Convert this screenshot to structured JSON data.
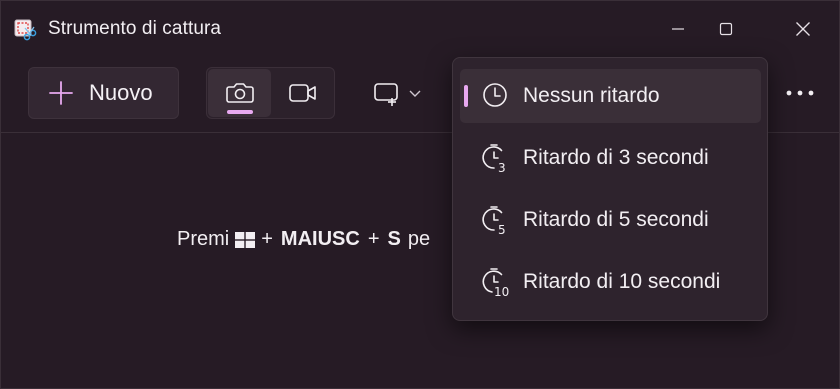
{
  "window": {
    "title": "Strumento di cattura"
  },
  "toolbar": {
    "new_label": "Nuovo"
  },
  "content": {
    "hint_prefix": "Premi",
    "hint_plus1": "+",
    "hint_key1": "MAIUSC",
    "hint_plus2": "+",
    "hint_key2": "S",
    "hint_suffix": "pe"
  },
  "delay_menu": {
    "items": [
      {
        "label": "Nessun ritardo",
        "badge": "",
        "selected": true
      },
      {
        "label": "Ritardo di 3 secondi",
        "badge": "3",
        "selected": false
      },
      {
        "label": "Ritardo di 5 secondi",
        "badge": "5",
        "selected": false
      },
      {
        "label": "Ritardo di 10 secondi",
        "badge": "10",
        "selected": false
      }
    ]
  },
  "colors": {
    "accent": "#e8a9f0",
    "background": "#261b25",
    "menu_background": "#2e232d"
  },
  "icons": {
    "app": "snipping-tool-icon",
    "new": "plus-icon",
    "photo_mode": "camera-icon",
    "video_mode": "video-camera-icon",
    "shape": "rectangle-snip-icon",
    "more": "more-options-icon"
  }
}
